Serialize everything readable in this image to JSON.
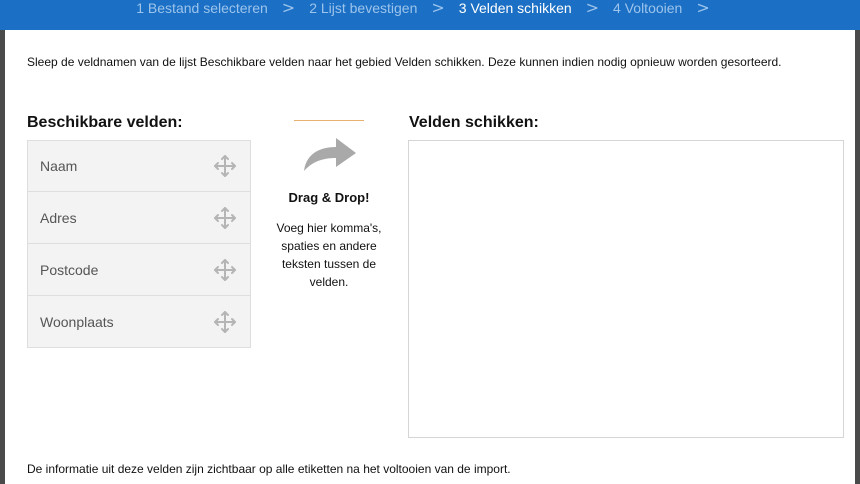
{
  "steps": [
    {
      "label": "1 Bestand selecteren",
      "active": false
    },
    {
      "label": "2 Lijst bevestigen",
      "active": false
    },
    {
      "label": "3 Velden schikken",
      "active": true
    },
    {
      "label": "4 Voltooien",
      "active": false
    }
  ],
  "step_separator": ">",
  "intro_text": "Sleep de veldnamen van de lijst Beschikbare velden naar het gebied Velden schikken. Deze kunnen indien nodig opnieuw worden gesorteerd.",
  "available_heading": "Beschikbare velden:",
  "arrange_heading": "Velden schikken:",
  "fields": [
    {
      "label": "Naam",
      "icon": "move-icon"
    },
    {
      "label": "Adres",
      "icon": "move-icon"
    },
    {
      "label": "Postcode",
      "icon": "move-icon"
    },
    {
      "label": "Woonplaats",
      "icon": "move-icon"
    }
  ],
  "drag_drop": {
    "title": "Drag & Drop!",
    "text": "Voeg hier komma's, spaties en andere teksten tussen de velden.",
    "icon": "curved-arrow-icon"
  },
  "footer_note": "De informatie uit deze velden zijn zichtbaar op alle etiketten na het voltooien van de import.",
  "colors": {
    "step_bar": "#1b6fc4",
    "step_inactive": "#9cc4ec",
    "step_active": "#ffffff",
    "accent_line": "#e9b070",
    "field_bg": "#f3f3f3"
  }
}
